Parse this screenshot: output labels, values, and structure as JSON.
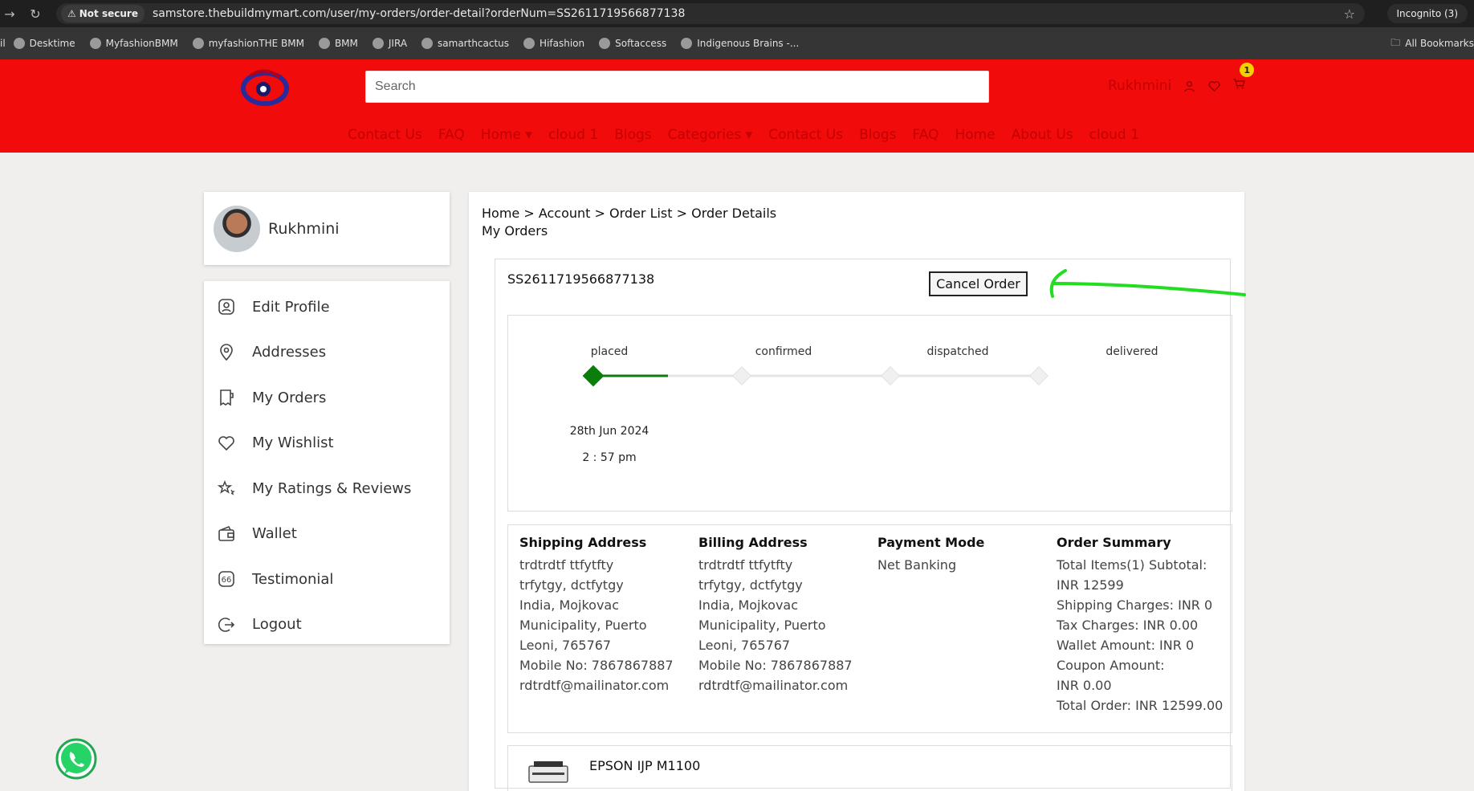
{
  "browser": {
    "not_secure": "Not secure",
    "url": "samstore.thebuildmymart.com/user/my-orders/order-detail?orderNum=SS2611719566877138",
    "incognito": "Incognito (3)",
    "bookmarks": [
      "Desktime",
      "MyfashionBMM",
      "myfashionTHE BMM",
      "BMM",
      "JIRA",
      "samarthcactus",
      "Hifashion",
      "Softaccess",
      "Indigenous Brains -..."
    ],
    "all_bookmarks": "All Bookmarks",
    "bookmark_prefix": "il"
  },
  "header": {
    "search_placeholder": "Search",
    "username": "Rukhmini",
    "cart_count": "1",
    "menu": [
      "Contact Us",
      "FAQ",
      "Home ▾",
      "cloud 1",
      "Blogs",
      "Categories ▾",
      "Contact Us",
      "Blogs",
      "FAQ",
      "Home",
      "About Us",
      "cloud 1"
    ]
  },
  "sidebar": {
    "profile_name": "Rukhmini",
    "items": [
      {
        "label": "Edit Profile",
        "icon": "user-icon"
      },
      {
        "label": "Addresses",
        "icon": "location-icon"
      },
      {
        "label": "My Orders",
        "icon": "orders-icon"
      },
      {
        "label": "My Wishlist",
        "icon": "heart-icon"
      },
      {
        "label": "My Ratings & Reviews",
        "icon": "stars-icon"
      },
      {
        "label": "Wallet",
        "icon": "wallet-icon"
      },
      {
        "label": "Testimonial",
        "icon": "quote-icon"
      },
      {
        "label": "Logout",
        "icon": "logout-icon"
      }
    ]
  },
  "main": {
    "breadcrumb": "Home > Account > Order List > Order Details",
    "subtitle": "My Orders",
    "order_number": "SS2611719566877138",
    "cancel_label": "Cancel Order",
    "steps": [
      "placed",
      "confirmed",
      "dispatched",
      "delivered"
    ],
    "current_step": 0,
    "placed_date": "28th Jun 2024",
    "placed_time": "2 : 57 pm",
    "shipping": {
      "title": "Shipping Address",
      "lines": [
        "trdtrdtf ttfytfty",
        "trfytgy, dctfytgy",
        "India, Mojkovac",
        "Municipality, Puerto",
        "Leoni, 765767",
        "Mobile No: 7867867887",
        "rdtrdtf@mailinator.com"
      ]
    },
    "billing": {
      "title": "Billing Address",
      "lines": [
        "trdtrdtf ttfytfty",
        "trfytgy, dctfytgy",
        "India, Mojkovac",
        "Municipality, Puerto",
        "Leoni, 765767",
        "Mobile No: 7867867887",
        "rdtrdtf@mailinator.com"
      ]
    },
    "payment": {
      "title": "Payment Mode",
      "lines": [
        "Net Banking"
      ]
    },
    "summary": {
      "title": "Order Summary",
      "lines": [
        "Total Items(1) Subtotal:",
        "INR 12599",
        "Shipping Charges: INR 0",
        "Tax Charges: INR 0.00",
        "Wallet Amount: INR 0",
        "Coupon Amount:",
        "INR 0.00",
        "Total Order: INR 12599.00"
      ]
    },
    "product_name": "EPSON IJP M1100"
  },
  "colors": {
    "header_red": "#f20b0b",
    "menu_text": "#c40000",
    "progress_green": "#0a7d0a",
    "annotation_green": "#22dd22"
  }
}
